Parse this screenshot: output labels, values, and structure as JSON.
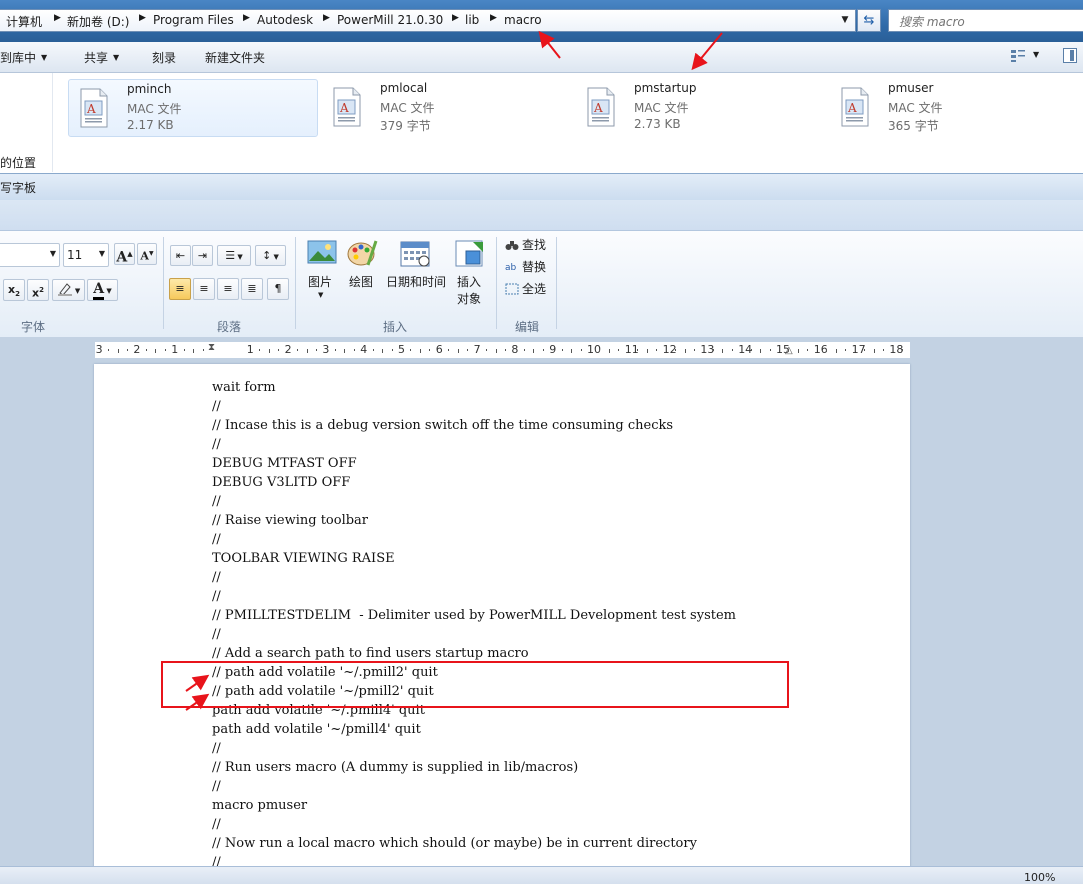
{
  "explorer": {
    "breadcrumb": [
      "计算机",
      "新加卷 (D:)",
      "Program Files",
      "Autodesk",
      "PowerMill 21.0.30",
      "lib",
      "macro"
    ],
    "search_placeholder": "搜索 macro",
    "commands": [
      "到库中",
      "共享",
      "刻录",
      "新建文件夹"
    ],
    "nav_items": [
      "的位置"
    ],
    "files": [
      {
        "name": "pminch",
        "type": "MAC 文件",
        "size": "2.17 KB"
      },
      {
        "name": "pmlocal",
        "type": "MAC 文件",
        "size": "379 字节"
      },
      {
        "name": "pmstartup",
        "type": "MAC 文件",
        "size": "2.73 KB"
      },
      {
        "name": "pmuser",
        "type": "MAC 文件",
        "size": "365 字节"
      }
    ]
  },
  "wordpad": {
    "title": "写字板",
    "font_size": "11",
    "groups": {
      "font": "字体",
      "paragraph": "段落",
      "insert": "插入",
      "edit": "编辑"
    },
    "insert_buttons": {
      "picture": "图片",
      "paint": "绘图",
      "datetime": "日期和时间",
      "object_l1": "插入",
      "object_l2": "对象"
    },
    "edit_buttons": {
      "find": "查找",
      "replace": "替换",
      "select_all": "全选"
    },
    "ruler_labels": [
      "3",
      "2",
      "1",
      "1",
      "2",
      "3",
      "4",
      "5",
      "6",
      "7",
      "8",
      "9",
      "10",
      "11",
      "12",
      "13",
      "14",
      "15",
      "16",
      "17",
      "18"
    ],
    "zoom": "100%",
    "document_lines": [
      "wait form",
      "//",
      "// Incase this is a debug version switch off the time consuming checks",
      "//",
      "DEBUG MTFAST OFF",
      "DEBUG V3LITD OFF",
      "//",
      "// Raise viewing toolbar",
      "//",
      "TOOLBAR VIEWING RAISE",
      "//",
      "//",
      "// PMILLTESTDELIM  - Delimiter used by PowerMILL Development test system",
      "//",
      "// Add a search path to find users startup macro",
      "// path add volatile '~/.pmill2' quit",
      "// path add volatile '~/pmill2' quit",
      "path add volatile '~/.pmill4' quit",
      "path add volatile '~/pmill4' quit",
      "//",
      "// Run users macro (A dummy is supplied in lib/macros)",
      "//",
      "macro pmuser",
      "//",
      "// Now run a local macro which should (or maybe) be in current directory",
      "//"
    ]
  },
  "colors": {
    "annotation": "#e8141b",
    "title_bar": "#2f6aa8"
  }
}
